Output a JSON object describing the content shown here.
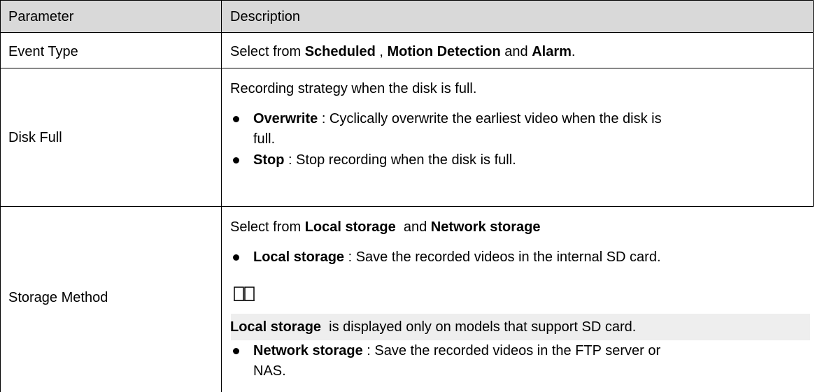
{
  "table": {
    "headers": {
      "parameter": "Parameter",
      "description": "Description"
    },
    "rows": [
      {
        "parameter": "Event Type",
        "description": {
          "prefix": "Select from ",
          "opt1": "Scheduled",
          "sep1": " , ",
          "opt2": "Motion Detection",
          "sep2": " and ",
          "opt3": "Alarm",
          "suffix": "."
        }
      },
      {
        "parameter": "Disk Full",
        "description": {
          "intro": "Recording strategy when the disk is full.",
          "bullets": [
            {
              "term": "Overwrite",
              "line1": " : Cyclically overwrite the earliest video when the disk is",
              "line2": "full."
            },
            {
              "term": "Stop",
              "line1": " : Stop recording when the disk is full."
            }
          ]
        }
      },
      {
        "parameter": "Storage Method",
        "description": {
          "intro_prefix": "Select from ",
          "intro_opt1": "Local storage",
          "intro_sep": "  and ",
          "intro_opt2": "Network storage",
          "bullets": [
            {
              "term": "Local storage",
              "line1": " : Save the recorded videos in the internal SD card."
            },
            {
              "term": "Network storage",
              "line1": " : Save the recorded videos in the FTP server or",
              "line2": "NAS."
            }
          ],
          "note": {
            "icon": "book-icon",
            "term": "Local storage",
            "text": "  is displayed only on models that support SD card."
          }
        }
      }
    ]
  }
}
